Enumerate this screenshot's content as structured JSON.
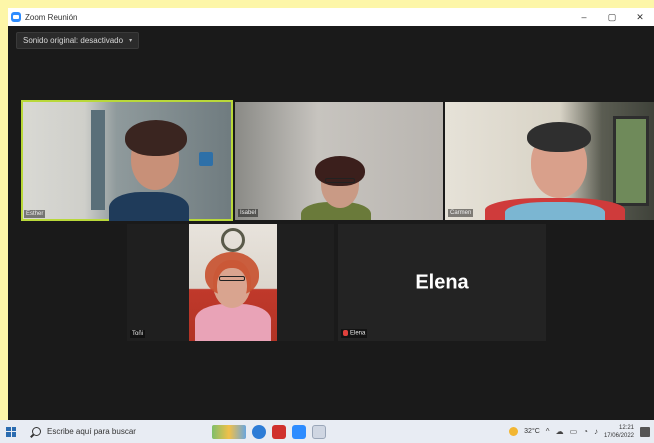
{
  "window": {
    "title": "Zoom Reunión",
    "controls": {
      "minimize": "–",
      "maximize": "▢",
      "close": "✕"
    }
  },
  "toolbar": {
    "audio_toggle_label": "Sonido original: desactivado",
    "audio_caret": "▾"
  },
  "participants": [
    {
      "name": "Esther",
      "video": true,
      "active_speaker": true
    },
    {
      "name": "Isabel",
      "video": true,
      "active_speaker": false
    },
    {
      "name": "Carmen",
      "video": true,
      "active_speaker": false
    },
    {
      "name": "Toñi",
      "video": true,
      "active_speaker": false
    },
    {
      "name": "Elena",
      "video": false,
      "muted": true,
      "display_text": "Elena"
    }
  ],
  "colors": {
    "meeting_background": "#1a1a1a",
    "active_speaker_outline": "#b9d83a",
    "muted_mic": "#e0413c",
    "taskbar": "#e8ecf3"
  },
  "taskbar": {
    "search_placeholder": "Escribe aquí para buscar",
    "pinned_icons": [
      "weather-widget-icon",
      "edge-icon",
      "acrobat-icon",
      "zoom-icon",
      "file-explorer-icon"
    ],
    "tray": {
      "temperature": "32°C",
      "time": "12:21",
      "date": "17/06/2022"
    }
  }
}
